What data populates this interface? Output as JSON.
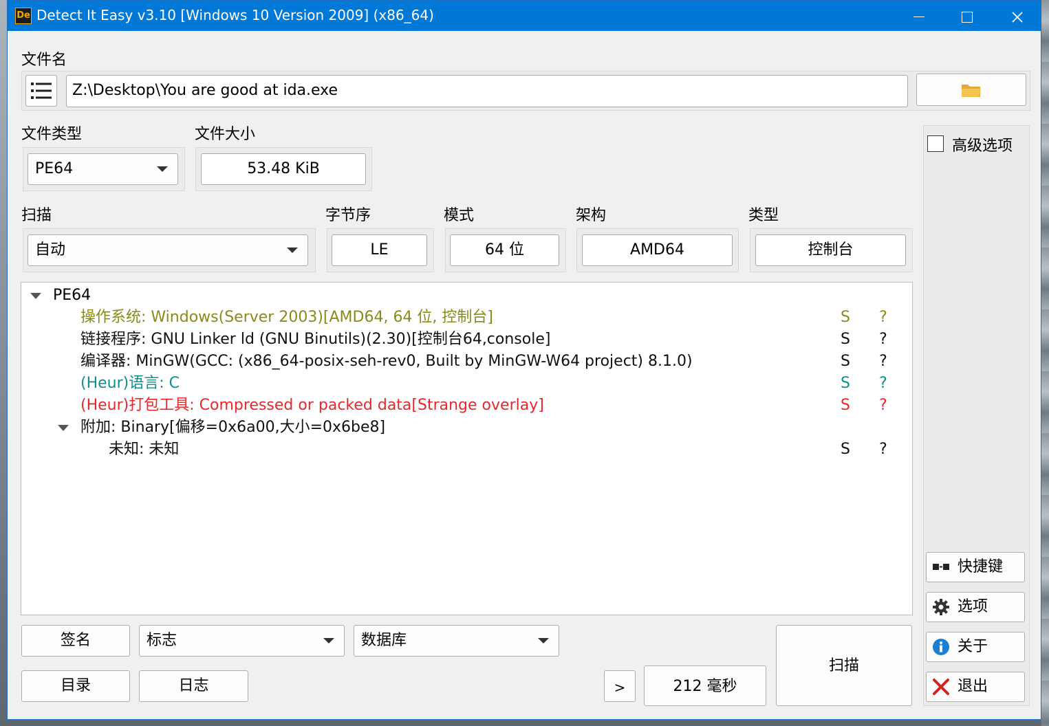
{
  "window": {
    "title": "Detect It Easy v3.10 [Windows 10 Version 2009] (x86_64)",
    "icon_text": "De"
  },
  "file": {
    "label": "文件名",
    "path": "Z:\\Desktop\\You are good at ida.exe"
  },
  "filetype": {
    "label": "文件类型",
    "value": "PE64"
  },
  "filesize": {
    "label": "文件大小",
    "value": "53.48 KiB"
  },
  "scan": {
    "label": "扫描",
    "value": "自动"
  },
  "endianness": {
    "label": "字节序",
    "value": "LE"
  },
  "mode": {
    "label": "模式",
    "value": "64 位"
  },
  "arch": {
    "label": "架构",
    "value": "AMD64"
  },
  "type": {
    "label": "类型",
    "value": "控制台"
  },
  "advanced": {
    "label": "高级选项",
    "checked": false
  },
  "results": {
    "root": "PE64",
    "rows": [
      {
        "text": "操作系统: Windows(Server 2003)[AMD64, 64 位, 控制台]",
        "s": "S",
        "q": "?",
        "color": "olive"
      },
      {
        "text": "链接程序: GNU Linker ld (GNU Binutils)(2.30)[控制台64,console]",
        "s": "S",
        "q": "?",
        "color": "black"
      },
      {
        "text": "编译器: MinGW(GCC: (x86_64-posix-seh-rev0, Built by MinGW-W64 project) 8.1.0)",
        "s": "S",
        "q": "?",
        "color": "black"
      },
      {
        "text": "(Heur)语言: C",
        "s": "S",
        "q": "?",
        "color": "teal"
      },
      {
        "text": "(Heur)打包工具: Compressed or packed data[Strange overlay]",
        "s": "S",
        "q": "?",
        "color": "red"
      }
    ],
    "overlay": {
      "text": "附加: Binary[偏移=0x6a00,大小=0x6be8]"
    },
    "overlay_child": {
      "text": "未知: 未知",
      "s": "S",
      "q": "?"
    }
  },
  "buttons": {
    "signatures": "签名",
    "flags": "标志",
    "database": "数据库",
    "directory": "目录",
    "log": "日志",
    "more": ">",
    "elapsed": "212 毫秒",
    "scan": "扫描",
    "shortcuts": "快捷键",
    "options": "选项",
    "about": "关于",
    "exit": "退出"
  },
  "icons": {
    "menu": "hamburger-icon",
    "open_folder": "folder-icon",
    "shortcuts": "shortcut-icon",
    "options": "gear-icon",
    "about": "info-icon",
    "exit": "close-icon"
  },
  "colors": {
    "titlebar": "#0078d7",
    "olive": "#8a8a1a",
    "teal": "#0e8e8e",
    "red": "#e8262b",
    "folder": "#f3c550"
  }
}
